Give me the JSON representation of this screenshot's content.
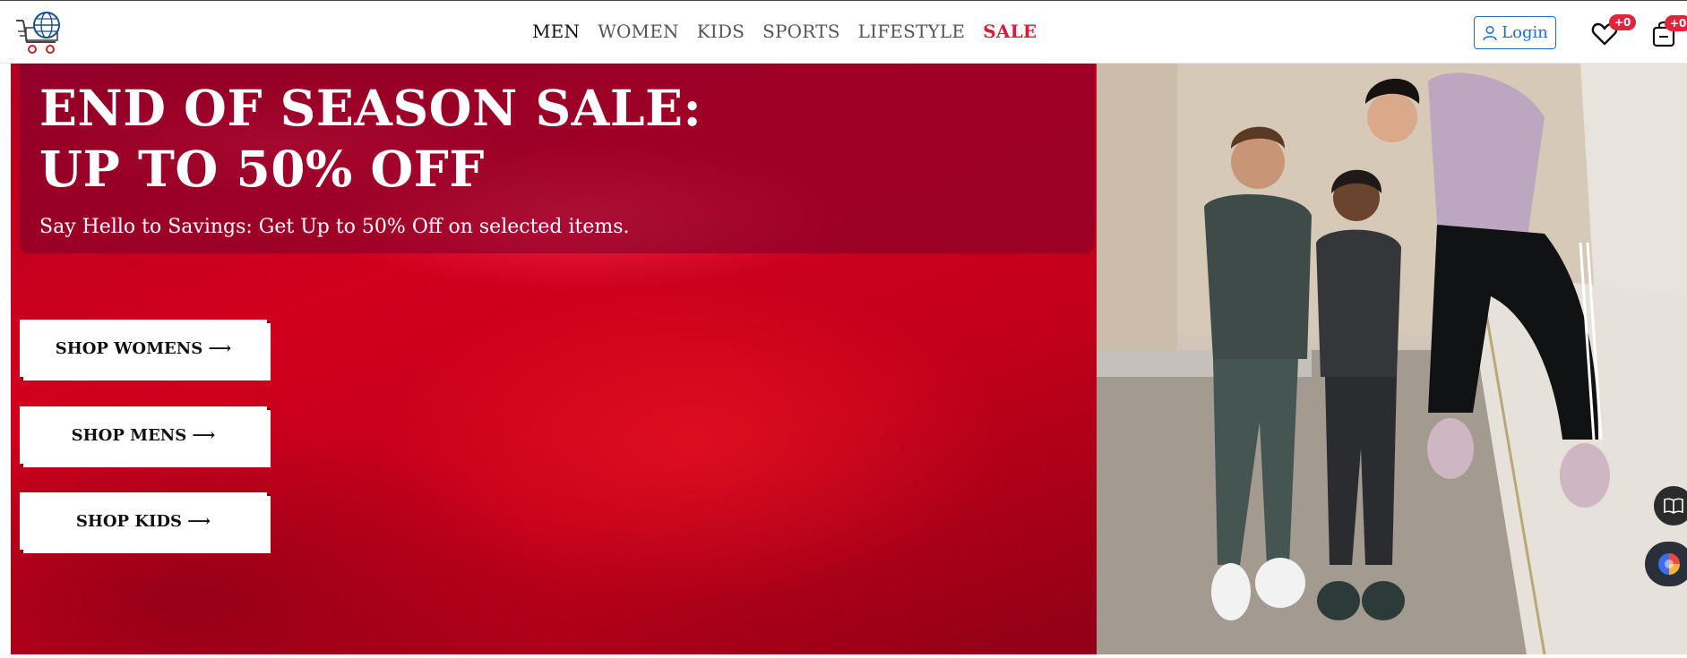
{
  "header": {
    "logo_icon": "globe-shopping-cart-icon",
    "nav": [
      {
        "label": "MEN",
        "active": true
      },
      {
        "label": "WOMEN"
      },
      {
        "label": "KIDS"
      },
      {
        "label": "SPORTS"
      },
      {
        "label": "LIFESTYLE"
      },
      {
        "label": "SALE",
        "highlight": true
      }
    ],
    "login_label": "Login",
    "wishlist_count": "+0",
    "cart_count": "+0"
  },
  "hero": {
    "title": "END OF SEASON SALE: UP TO 50% OFF",
    "subtitle": "Say Hello to Savings: Get Up to 50% Off on selected items.",
    "buttons": [
      {
        "label": "SHOP WOMENS ⟶"
      },
      {
        "label": "SHOP MENS ⟶"
      },
      {
        "label": "SHOP KIDS ⟶"
      }
    ],
    "photo_icon": "people-sportswear-photo"
  },
  "colors": {
    "brand_red": "#d81b36",
    "login_blue": "#1f6fd1",
    "badge_red": "#e0243b"
  }
}
